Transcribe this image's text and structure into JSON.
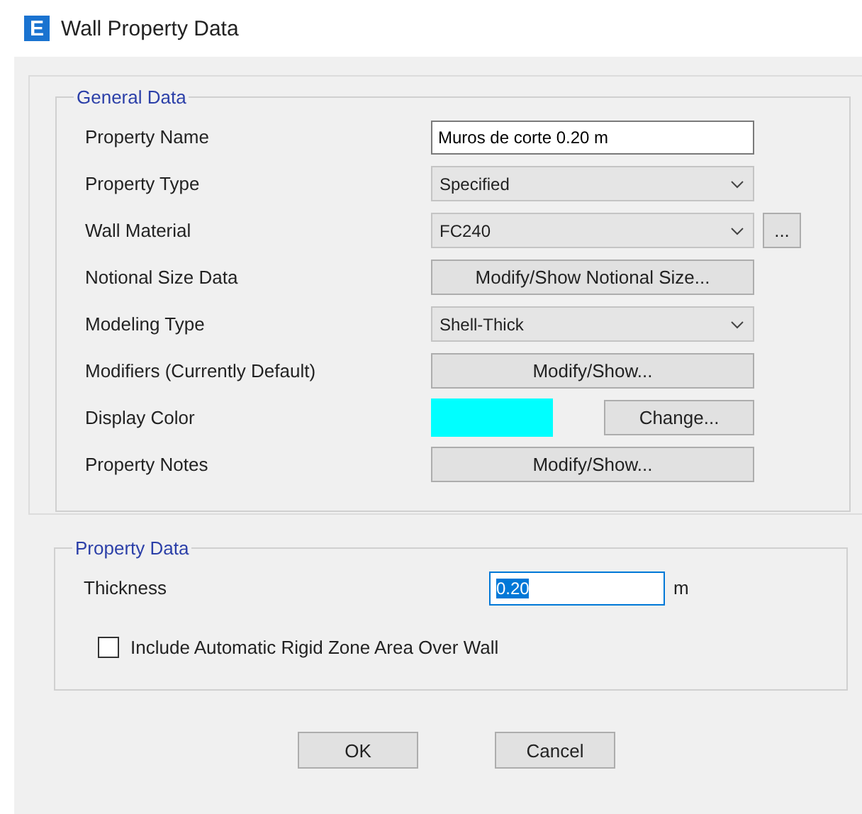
{
  "window": {
    "logo": "E",
    "title": "Wall Property Data"
  },
  "general_data": {
    "title": "General Data",
    "rows": [
      {
        "label": "Property Name",
        "kind": "text",
        "value": "Muros de corte 0.20 m"
      },
      {
        "label": "Property Type",
        "kind": "dropdown",
        "value": "Specified"
      },
      {
        "label": "Wall Material",
        "kind": "dropdown",
        "value": "FC240",
        "extra_button": "..."
      },
      {
        "label": "Notional Size Data",
        "kind": "button",
        "value": "Modify/Show Notional Size..."
      },
      {
        "label": "Modeling Type",
        "kind": "dropdown",
        "value": "Shell-Thick"
      },
      {
        "label": "Modifiers (Currently Default)",
        "kind": "button",
        "value": "Modify/Show..."
      },
      {
        "label": "Display Color",
        "kind": "color",
        "color": "#00ffff",
        "value": "Change..."
      },
      {
        "label": "Property Notes",
        "kind": "button",
        "value": "Modify/Show..."
      }
    ]
  },
  "property_data": {
    "title": "Property Data",
    "thickness": {
      "label": "Thickness",
      "value": "0.20",
      "value_selected": true,
      "unit": "m"
    },
    "rigid_zone": {
      "label": "Include Automatic Rigid Zone Area Over Wall",
      "checked": false
    }
  },
  "buttons": [
    "OK",
    "Cancel"
  ]
}
